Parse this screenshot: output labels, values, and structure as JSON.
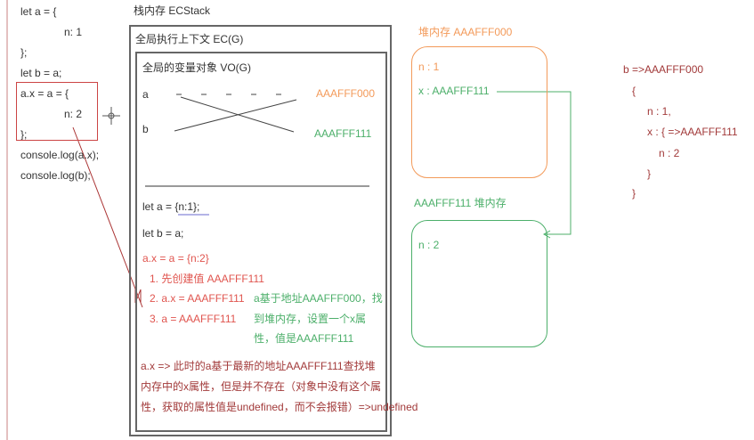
{
  "code": [
    "let a = {",
    "n: 1",
    "};",
    "let b = a;",
    "a.x = a = {",
    "n: 2",
    "};",
    "console.log(a.x);",
    "console.log(b);"
  ],
  "stack_title": "栈内存  ECStack",
  "ec_title": "全局执行上下文   EC(G)",
  "vo_title": "全局的变量对象   VO(G)",
  "vars": {
    "a": "a",
    "b": "b",
    "addr_a": "AAAFFF000",
    "addr_b": "AAAFFF111"
  },
  "steps": {
    "s1": "let a = {n:1};",
    "s2": "let b = a;",
    "s3": "a.x = a = {n:2}",
    "s3_1": "1. 先创建值 AAAFFF111",
    "s3_2": "2. a.x = AAAFFF111",
    "s3_3": "3. a = AAAFFF111",
    "note": [
      "a基于地址AAAFFF000，找",
      "到堆内存，设置一个x属",
      "性，值是AAAFFF111"
    ],
    "result": [
      "a.x  => 此时的a基于最新的地址AAAFFF111查找堆",
      "内存中的x属性，但是并不存在（对象中没有这个属",
      "性，获取的属性值是undefined，而不会报错）=>undefined"
    ]
  },
  "heap1": {
    "title": "堆内存 AAAFFF000",
    "n": "n : 1",
    "x": "x : AAAFFF111"
  },
  "heap2": {
    "title": "AAAFFF111  堆内存",
    "n": "n : 2"
  },
  "b_expr": [
    "b =>AAAFFF000",
    "{",
    "n : 1,",
    "x : {  =>AAAFFF111",
    "n : 2",
    "}",
    "}"
  ],
  "colors": {
    "orange": "#f39a5a",
    "green": "#4caf6a",
    "red": "#e0554f",
    "dark_red": "#a23a3a"
  }
}
